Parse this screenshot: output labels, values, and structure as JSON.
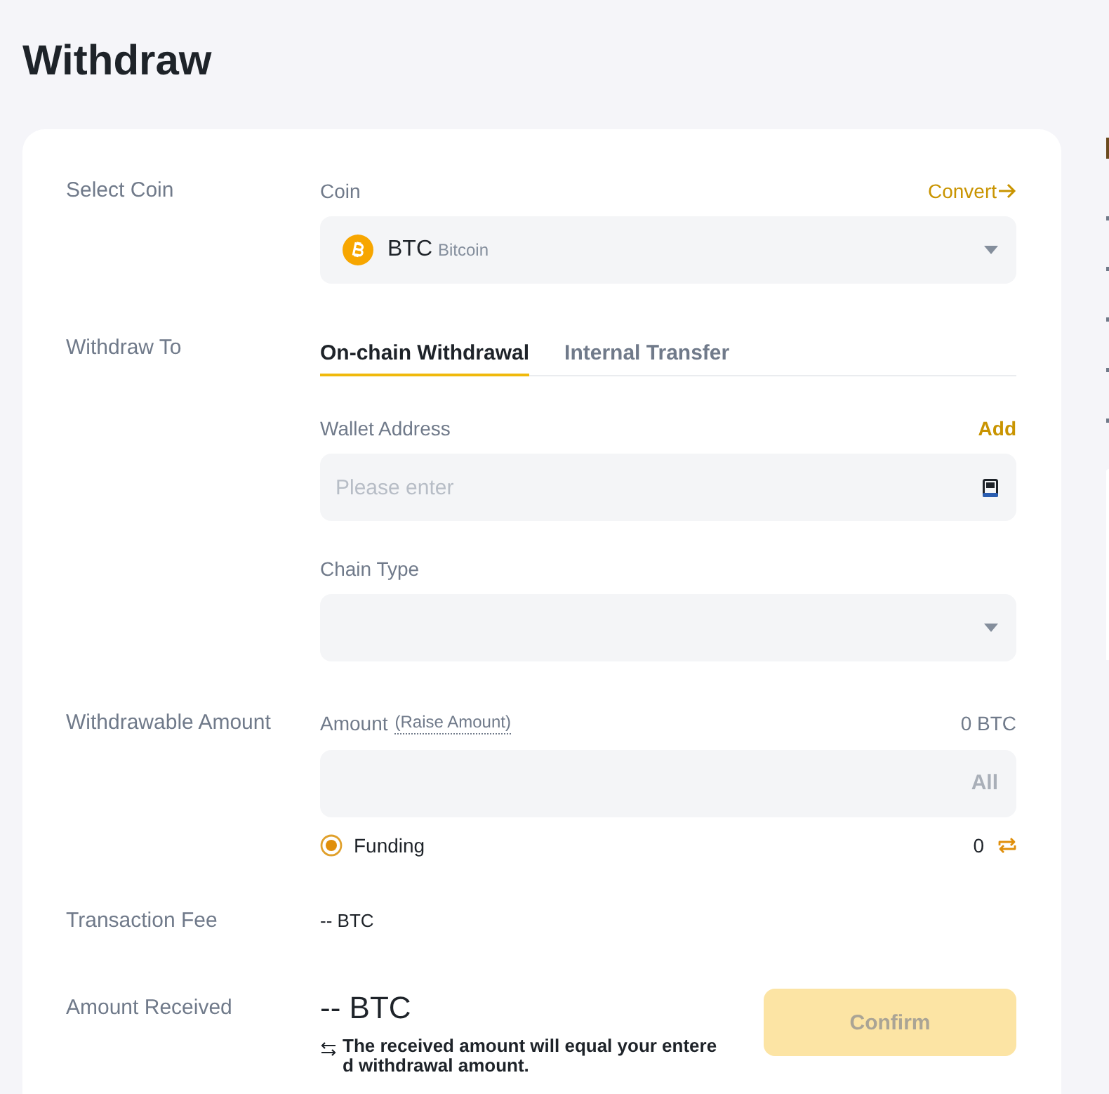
{
  "title": "Withdraw",
  "select_coin": {
    "label": "Select Coin",
    "field_label": "Coin",
    "convert_link": "Convert",
    "coin": {
      "symbol": "BTC",
      "name": "Bitcoin"
    }
  },
  "withdraw_to": {
    "label": "Withdraw To",
    "tabs": [
      {
        "label": "On-chain Withdrawal",
        "selected": true
      },
      {
        "label": "Internal Transfer",
        "selected": false
      }
    ],
    "wallet_address": {
      "label": "Wallet Address",
      "add_link": "Add",
      "placeholder": "Please enter"
    },
    "chain_type": {
      "label": "Chain Type"
    }
  },
  "withdrawable_amount": {
    "label": "Withdrawable Amount",
    "field_label": "Amount",
    "raise_link": "(Raise Amount)",
    "balance": "0 BTC",
    "max_button": {
      "label": "All",
      "disabled": true
    },
    "accounts": [
      {
        "label": "Funding",
        "selected": true,
        "balance": "0"
      }
    ]
  },
  "transaction_fee": {
    "label": "Transaction Fee",
    "value": "-- BTC"
  },
  "amount_received": {
    "label": "Amount Received",
    "value": "-- BTC",
    "note": "The received amount will equal your entered withdrawal amount."
  },
  "confirm_button": {
    "label": "Confirm",
    "disabled": true
  }
}
